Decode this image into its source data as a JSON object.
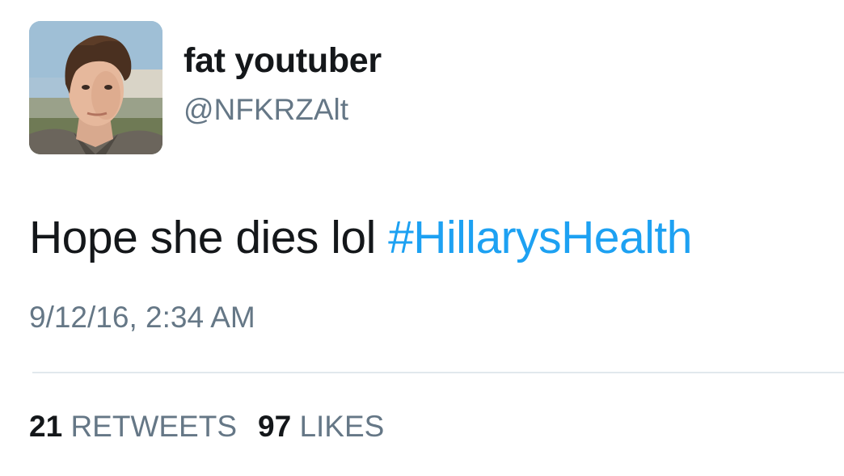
{
  "user": {
    "display_name": "fat youtuber",
    "handle": "@NFKRZAlt",
    "avatar_icon": "profile-photo"
  },
  "tweet": {
    "text": "Hope she dies lol ",
    "hashtag": "#HillarysHealth",
    "timestamp": "9/12/16, 2:34 AM"
  },
  "stats": {
    "retweets_count": "21",
    "retweets_label": "RETWEETS",
    "likes_count": "97",
    "likes_label": "LIKES"
  },
  "colors": {
    "text_primary": "#14171a",
    "text_secondary": "#657786",
    "link": "#1da1f2",
    "divider": "#e1e8ed",
    "background": "#ffffff"
  }
}
